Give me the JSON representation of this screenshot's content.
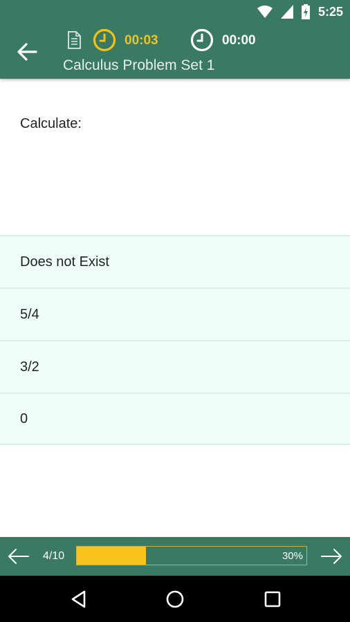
{
  "status_bar": {
    "time": "5:25",
    "icons": [
      "wifi-icon",
      "signal-icon",
      "battery-icon"
    ]
  },
  "app_bar": {
    "title": "Calculus Problem Set 1",
    "timer_elapsed": "00:03",
    "timer_total": "00:00",
    "icons": [
      "back-arrow-icon",
      "document-icon",
      "clock-icon"
    ],
    "colors": {
      "background": "#3a7a63",
      "timer_accent": "#f2c218"
    }
  },
  "question": {
    "text": "Calculate:"
  },
  "answers": [
    {
      "label": "Does not Exist"
    },
    {
      "label": "5/4"
    },
    {
      "label": "3/2"
    },
    {
      "label": "0"
    }
  ],
  "bottom_bar": {
    "page_counter": "4/10",
    "progress_label": "30%",
    "progress_value": 0.3,
    "colors": {
      "progress_fill": "#f7c31c",
      "answer_background": "#effdf8"
    }
  },
  "nav_bar": {
    "icons": [
      "back-triangle-icon",
      "home-circle-icon",
      "recents-square-icon"
    ]
  }
}
